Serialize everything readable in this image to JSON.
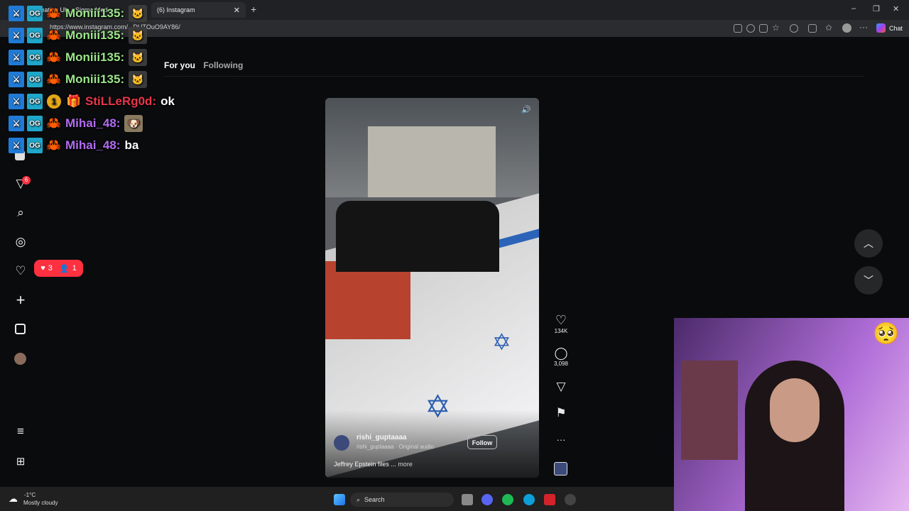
{
  "browser": {
    "tabs": [
      {
        "label": "Creating Uh... Sigma Mod..."
      },
      {
        "label": "(6) Instagram"
      }
    ],
    "url": "https://www.instagram.com/...DUTOuO9AY86/",
    "chat_button": "Chat"
  },
  "instagram": {
    "feed_tabs": {
      "for_you": "For you",
      "following": "Following"
    },
    "notification_badge": "6",
    "activity_popup": {
      "likes": "3",
      "follows": "1"
    },
    "post": {
      "username": "rishi_guptaaaa",
      "audio": "rishi_guptaaaa · Original audio",
      "follow": "Follow",
      "caption": "Jeffrey Epstein files ...",
      "more": "more",
      "likes": "134K",
      "comments": "3,098"
    }
  },
  "chat": {
    "messages": [
      {
        "user": "Moniii135:",
        "text": "",
        "color": "#9be58a",
        "emote": "cat"
      },
      {
        "user": "Moniii135:",
        "text": "",
        "color": "#9be58a",
        "emote": "cat"
      },
      {
        "user": "Moniii135:",
        "text": "",
        "color": "#9be58a",
        "emote": "cat"
      },
      {
        "user": "Moniii135:",
        "text": "",
        "color": "#9be58a",
        "emote": "cat"
      },
      {
        "user": "StiLLeRg0d:",
        "text": "ok",
        "color": "#e8364a",
        "emote": ""
      },
      {
        "user": "Mihai_48:",
        "text": "",
        "color": "#b26cf0",
        "emote": "dog"
      },
      {
        "user": "Mihai_48:",
        "text": "ba",
        "color": "#b26cf0",
        "emote": ""
      }
    ],
    "sub_badge": "1"
  },
  "taskbar": {
    "weather_temp": "-1°C",
    "weather_desc": "Mostly cloudy",
    "search": "Search"
  },
  "colors": {
    "accent_red": "#ff3040",
    "mod_blue": "#1f7bd6"
  }
}
